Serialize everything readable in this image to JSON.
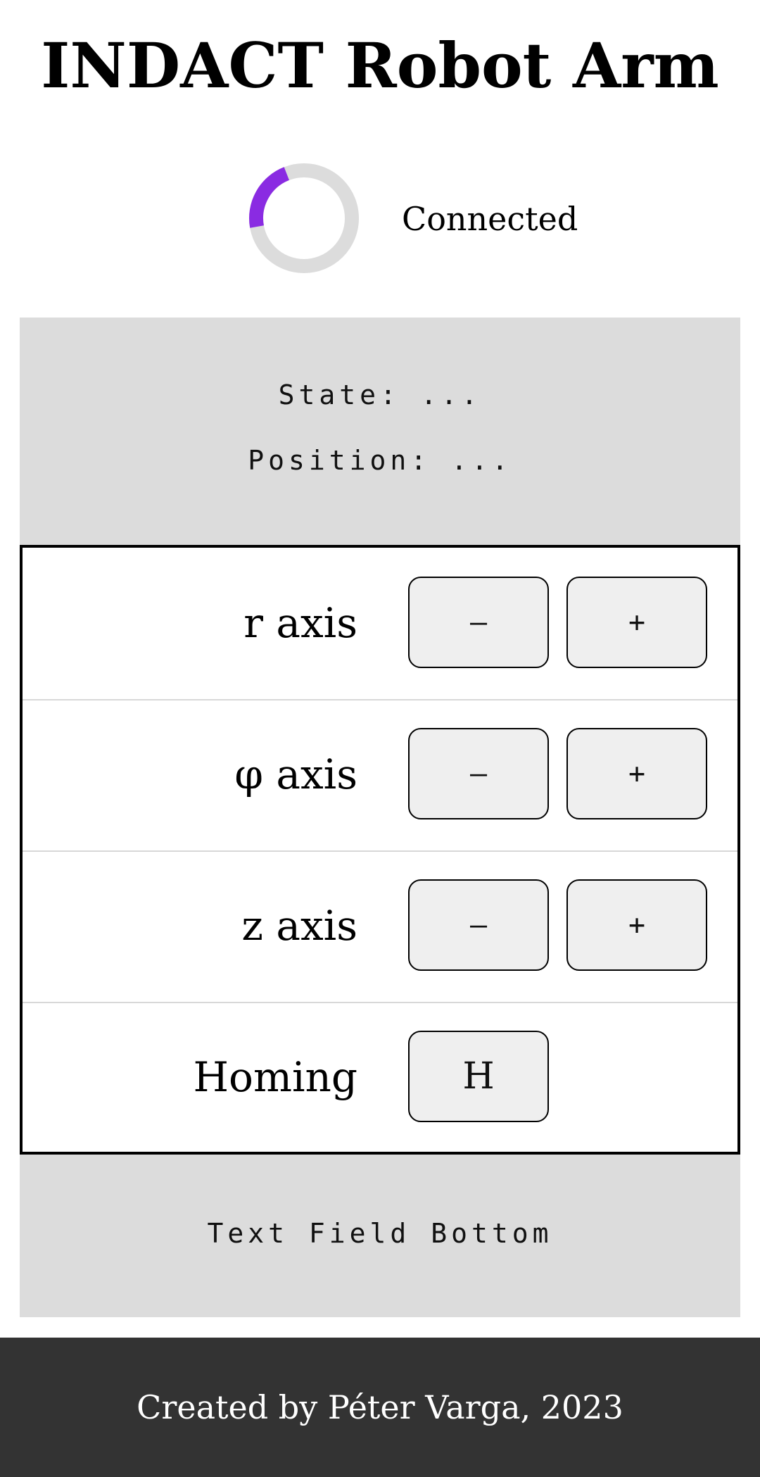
{
  "header": {
    "title": "INDACT Robot Arm"
  },
  "connection": {
    "status_text": "Connected",
    "spinner_accent_color": "#8a2be2",
    "spinner_track_color": "#dcdcdc"
  },
  "info_panel": {
    "state_text": "State: ...",
    "position_text": "Position: ..."
  },
  "controls": {
    "rows": [
      {
        "label": "r axis",
        "minus_label": "–",
        "plus_label": "+"
      },
      {
        "label": "φ axis",
        "minus_label": "–",
        "plus_label": "+"
      },
      {
        "label": "z axis",
        "minus_label": "–",
        "plus_label": "+"
      },
      {
        "label": "Homing",
        "button_label": "H"
      }
    ]
  },
  "bottom_panel": {
    "text": "Text Field Bottom"
  },
  "footer": {
    "text": "Created by Péter Varga, 2023"
  }
}
